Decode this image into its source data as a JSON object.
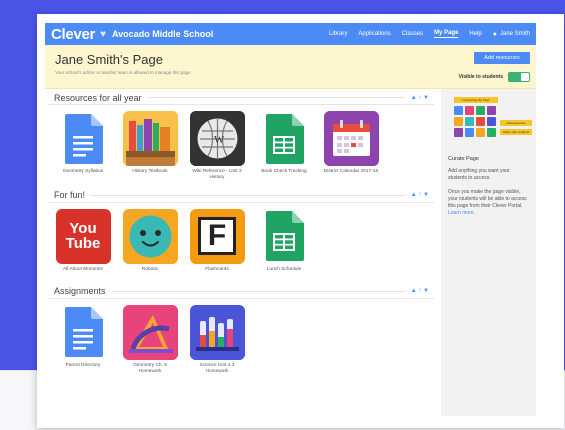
{
  "nav": {
    "logo": "Clever",
    "school": "Avocado Middle School",
    "links": [
      "Library",
      "Applications",
      "Classes",
      "My Page",
      "Help"
    ],
    "active_link": "My Page",
    "user": "Jane Smith"
  },
  "header": {
    "title": "Jane Smith's Page",
    "subtitle": "Your school's admin or teacher team is allowed to manage this page",
    "add_button": "Add resources",
    "visible_label": "Visible to students"
  },
  "sections": [
    {
      "title": "Resources for all year",
      "apps": [
        {
          "label": "Geometry Syllabus",
          "icon": "google-docs-icon"
        },
        {
          "label": "History Textbook",
          "icon": "books-icon"
        },
        {
          "label": "Wiki Reference - Unit 2 History",
          "icon": "wikipedia-icon"
        },
        {
          "label": "Book Check Tracking",
          "icon": "google-sheets-icon"
        },
        {
          "label": "District Calendar 2017-18",
          "icon": "calendar-icon"
        }
      ]
    },
    {
      "title": "For fun!",
      "apps": [
        {
          "label": "All About Moments",
          "icon": "youtube-icon",
          "text": "You Tube"
        },
        {
          "label": "Robotic",
          "icon": "smiley-icon"
        },
        {
          "label": "Flashcards",
          "icon": "f-letter-icon",
          "text": "F"
        },
        {
          "label": "Lunch Schedule",
          "icon": "google-sheets-icon"
        }
      ]
    },
    {
      "title": "Assignments",
      "apps": [
        {
          "label": "Parent Directory",
          "icon": "google-docs-icon"
        },
        {
          "label": "Geometry Ch. 5 Homework",
          "icon": "geometry-tools-icon"
        },
        {
          "label": "Science Unit 4.3 Homework",
          "icon": "lab-beakers-icon"
        }
      ]
    }
  ],
  "sidebar": {
    "promo_tag": "Introducing My Page",
    "promo_badge_1": "Add resources",
    "promo_badge_2": "Share with students",
    "heading": "Curate Page",
    "text_1": "Add anything you want your students to access.",
    "text_2": "Once you make the page visible, your students will be able to access this page from their Clever Portal.",
    "link": "Learn more."
  },
  "arrows": "▲ ↑ ▼",
  "colors": {
    "brand": "#4c8bf5",
    "background": "#4a55e8",
    "header_bg": "#fdf6cf",
    "toggle_on": "#3ab27a",
    "docs": "#4c8bf5",
    "sheets": "#20a463",
    "youtube": "#d9322a",
    "calendar": "#8e44ad"
  }
}
